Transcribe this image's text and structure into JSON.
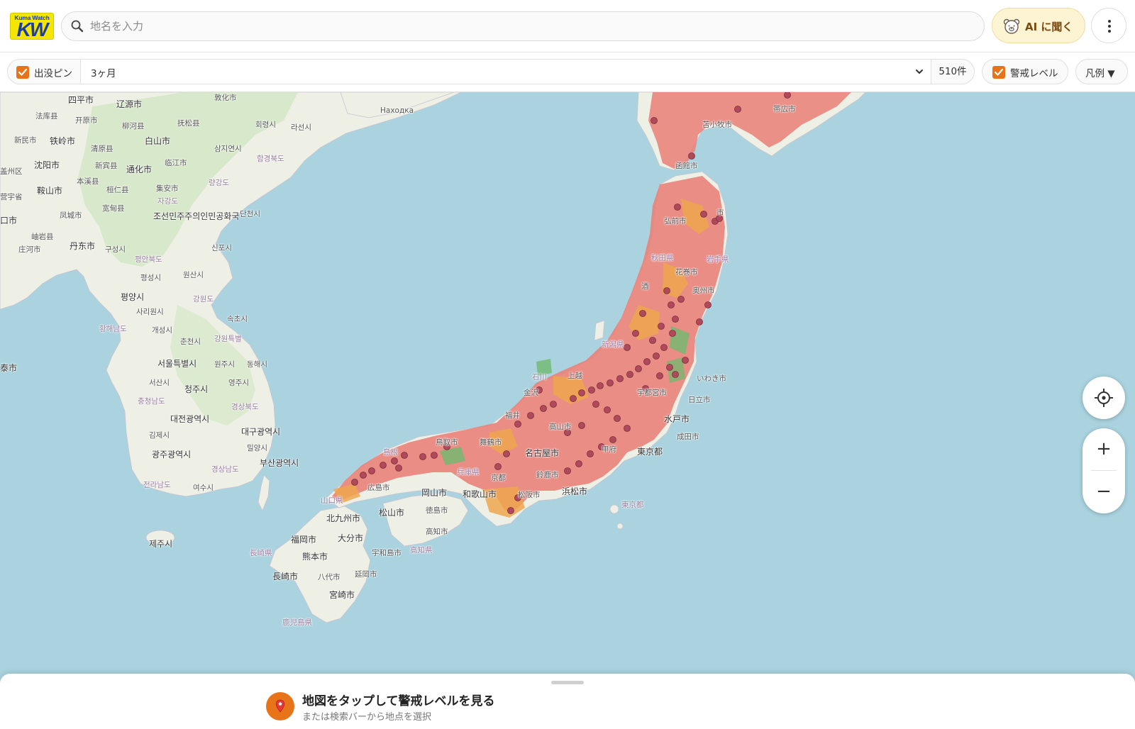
{
  "header": {
    "logo_top": "Kuma Watch",
    "logo_main": "KW",
    "search_placeholder": "地名を入力",
    "ai_label": "AI に聞く"
  },
  "filters": {
    "sightings_label": "出没ピン",
    "sightings_checked": true,
    "period_value": "3ヶ月",
    "count_label": "510件",
    "alert_label": "警戒レベル",
    "alert_checked": true,
    "legend_label": "凡例 ▼"
  },
  "map": {
    "labels": {
      "shiping": "四平市",
      "liaoyuan": "辽源市",
      "dunhua": "敦化市",
      "faku": "法库县",
      "kaiyuan": "开原市",
      "liuhe": "柳河县",
      "fusong": "抚松县",
      "hoeryong": "회령시",
      "rason": "라선시",
      "nakhodka": "Находка",
      "tieling": "铁岭市",
      "xinmin": "新民市",
      "qingyuan": "清原县",
      "baishan": "白山市",
      "samjiyon": "삼지연시",
      "shenyang": "沈阳市",
      "xinbin": "新宾县",
      "tonghua": "通化市",
      "linjiang": "临江市",
      "hamgyong": "함경북도",
      "benxi": "本溪县",
      "huanren": "桓仁县",
      "ryanggang": "량강도",
      "anshan": "鞍山市",
      "jian": "集安市",
      "jagang": "자강도",
      "fengcheng": "凤城市",
      "kuandian": "宽甸县",
      "dprk": "조선민주주의인민공화국",
      "dancheon": "단천시",
      "xiuyan": "岫岩县",
      "dandong": "丹东市",
      "kuseong": "구성시",
      "sinpo": "신포시",
      "zhuanghe": "庄河市",
      "pyongbuk": "평안북도",
      "pyongsong": "평성시",
      "wonsan": "원산시",
      "pyongyang": "평양시",
      "sariwon": "사리원시",
      "kangwon": "강원도",
      "sokcho": "속초시",
      "hwanghae": "황해남도",
      "kaesong": "개성시",
      "chuncheon": "춘천시",
      "gangwondo": "강원특별",
      "seoul": "서울특별시",
      "wonju": "원주시",
      "donghae": "동해시",
      "seosan": "서산시",
      "cheongju": "청주시",
      "yeongju": "영주시",
      "chungnam": "충청남도",
      "gyeongbuk": "경상북도",
      "daejeon": "대전광역시",
      "gimje": "김제시",
      "daegu": "대구광역시",
      "gwangju": "광주광역시",
      "miryang": "밀양시",
      "busan": "부산광역시",
      "gyeongnam": "경상남도",
      "jeonnam": "전라남도",
      "yeosu": "여수시",
      "jeju": "제주시",
      "obihiro": "帯広市",
      "tomakomai": "苫小牧市",
      "hakodate": "函館市",
      "hachinohe": "市",
      "hirosaki": "弘前市",
      "akita": "秋田県",
      "iwate": "岩手県",
      "hanamaki": "花巻市",
      "sakata": "酒",
      "oshu": "奥州市",
      "niigata": "新潟県",
      "iwaki": "いわき市",
      "joetsu": "上越",
      "ishikawa": "石川",
      "kanazawa": "金沢",
      "utsunomiya": "宇都宮市",
      "hitachi": "日立市",
      "fukui": "福井",
      "takayama": "高山市",
      "mito": "水戸市",
      "narita": "成田市",
      "tokyo": "東京都",
      "tottori": "鳥取市",
      "maizuru": "舞鶴市",
      "nagoya": "名古屋市",
      "kofu": "甲府",
      "shimane": "島根",
      "hyogo": "兵庫県",
      "kyoto": "京都",
      "suzuka": "鈴鹿市",
      "hiroshima": "広島市",
      "okayama": "岡山市",
      "wakayama": "和歌山市",
      "matsusaka": "松阪市",
      "hamamatsu": "浜松市",
      "yamaguchi": "山口県",
      "matsuyama": "松山市",
      "tokushima": "徳島市",
      "tokyo_islands": "東京都",
      "kitakyushu": "北九州市",
      "kochi": "高知市",
      "fukuoka": "福岡市",
      "oita": "大分市",
      "uwajima": "宇和島市",
      "kochi_pref": "高知県",
      "nagasaki_pref": "長崎県",
      "kumamoto": "熊本市",
      "nagasaki": "長崎市",
      "yatsushiro": "八代市",
      "nobeoka": "延岡市",
      "miyazaki": "宮崎市",
      "kagoshima_pref": "鹿児島県",
      "taishi": "泰市",
      "yingkou": "营宇省",
      "kou": "口市",
      "gaizhou": "盖州区"
    }
  },
  "controls": {
    "zoom_in": "+",
    "zoom_out": "−"
  },
  "sheet": {
    "title": "地図をタップして警戒レベルを見る",
    "subtitle": "または検索バーから地点を選択"
  },
  "colors": {
    "accent": "#e8741a",
    "sea": "#aad3df",
    "land": "#f2efe9",
    "alert_high": "#e9827a",
    "alert_mid": "#eea64e",
    "alert_low": "#6fba6f",
    "pin": "#b04a5a"
  }
}
